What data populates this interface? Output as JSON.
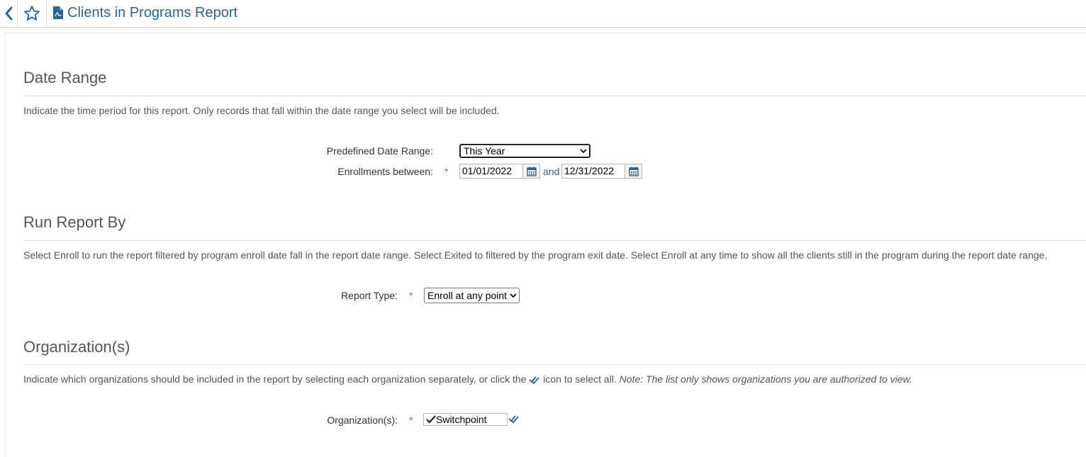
{
  "header": {
    "title": "Clients in Programs Report",
    "icons": {
      "back": "chevron-left-icon",
      "favorite": "star-outline-icon",
      "report": "pdf-file-icon"
    }
  },
  "colors": {
    "link": "#2a6496",
    "required": "#d9534f",
    "text": "#555555"
  },
  "date_range": {
    "title": "Date Range",
    "description": "Indicate the time period for this report. Only records that fall within the date range you select will be included.",
    "predefined_label": "Predefined Date Range:",
    "predefined_value": "This Year",
    "enrollments_label": "Enrollments between:",
    "required_marker": "*",
    "start_date": "01/01/2022",
    "and_label": "and",
    "end_date": "12/31/2022"
  },
  "run_report_by": {
    "title": "Run Report By",
    "description": "Select Enroll to run the report filtered by program enroll date fall in the report date range. Select Exited to filtered by the program exit date. Select Enroll at any time to show all the clients still in the program during the report date range.",
    "report_type_label": "Report Type:",
    "required_marker": "*",
    "report_type_value": "Enroll at any point"
  },
  "organizations": {
    "title": "Organization(s)",
    "description_before": "Indicate which organizations should be included in the report by selecting each organization separately, or click the",
    "description_after": "icon to select all.",
    "description_note": "Note: The list only shows organizations you are authorized to view.",
    "label": "Organization(s):",
    "required_marker": "*",
    "selected": "Switchpoint"
  }
}
